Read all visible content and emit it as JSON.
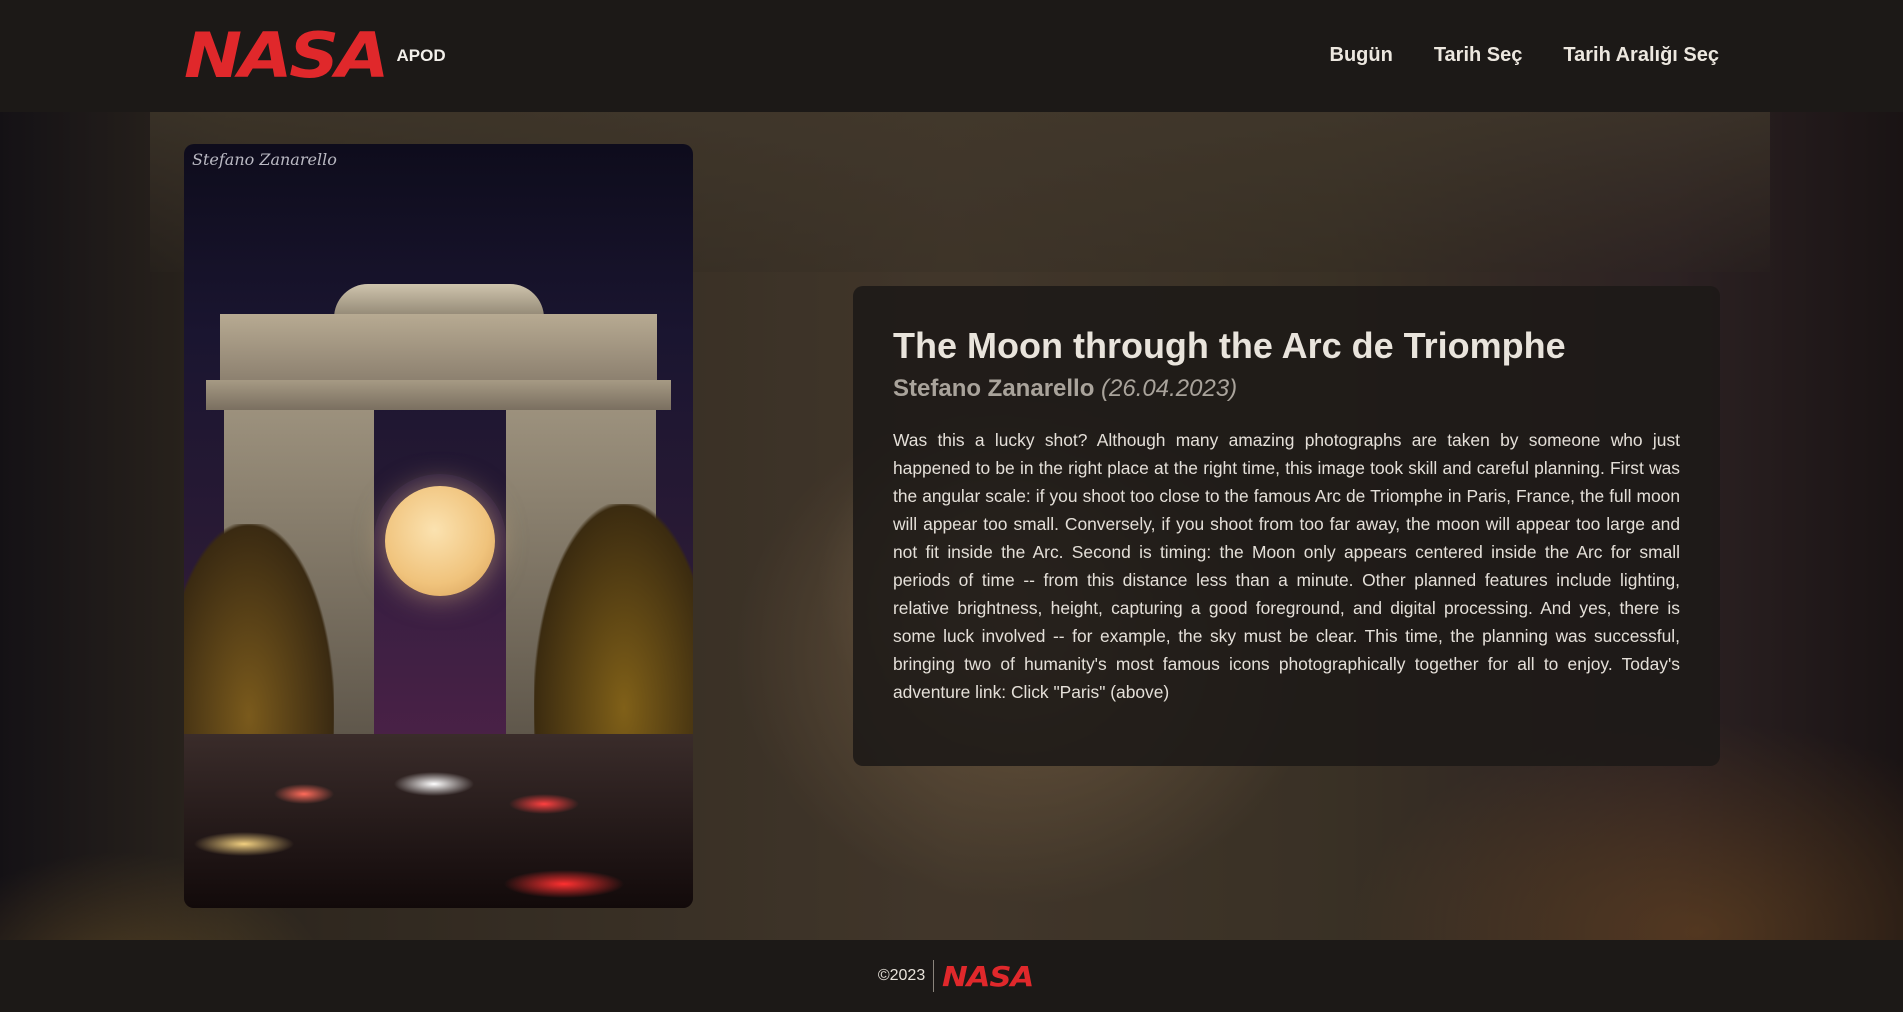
{
  "header": {
    "logo_text": "NASA",
    "app_label": "APOD",
    "nav": [
      {
        "label": "Bugün"
      },
      {
        "label": "Tarih Seç"
      },
      {
        "label": "Tarih Aralığı Seç"
      }
    ]
  },
  "photo": {
    "signature": "Stefano Zanarello"
  },
  "article": {
    "title": "The Moon through the Arc de Triomphe",
    "author": "Stefano Zanarello",
    "date": "(26.04.2023)",
    "explanation": "Was this a lucky shot? Although many amazing photographs are taken by someone who just happened to be in the right place at the right time, this image took skill and careful planning. First was the angular scale: if you shoot too close to the famous Arc de Triomphe in Paris, France, the full moon will appear too small.  Conversely, if you shoot from too far away, the moon will appear too large and not fit inside the Arc. Second is timing: the Moon only appears centered inside the Arc for small periods of time -- from this distance less than a minute. Other planned features include lighting, relative brightness, height, capturing a good foreground, and digital processing. And yes, there is some luck involved -- for example, the sky must be clear. This time, the planning was successful, bringing two of humanity's most famous icons photographically together for all to enjoy. Today's adventure link: Click \"Paris\" (above)"
  },
  "footer": {
    "copyright": "©2023",
    "logo_text": "NASA"
  },
  "colors": {
    "brand_red": "#e0282b",
    "header_bg": "#1c1917",
    "card_bg": "#1c1917"
  }
}
